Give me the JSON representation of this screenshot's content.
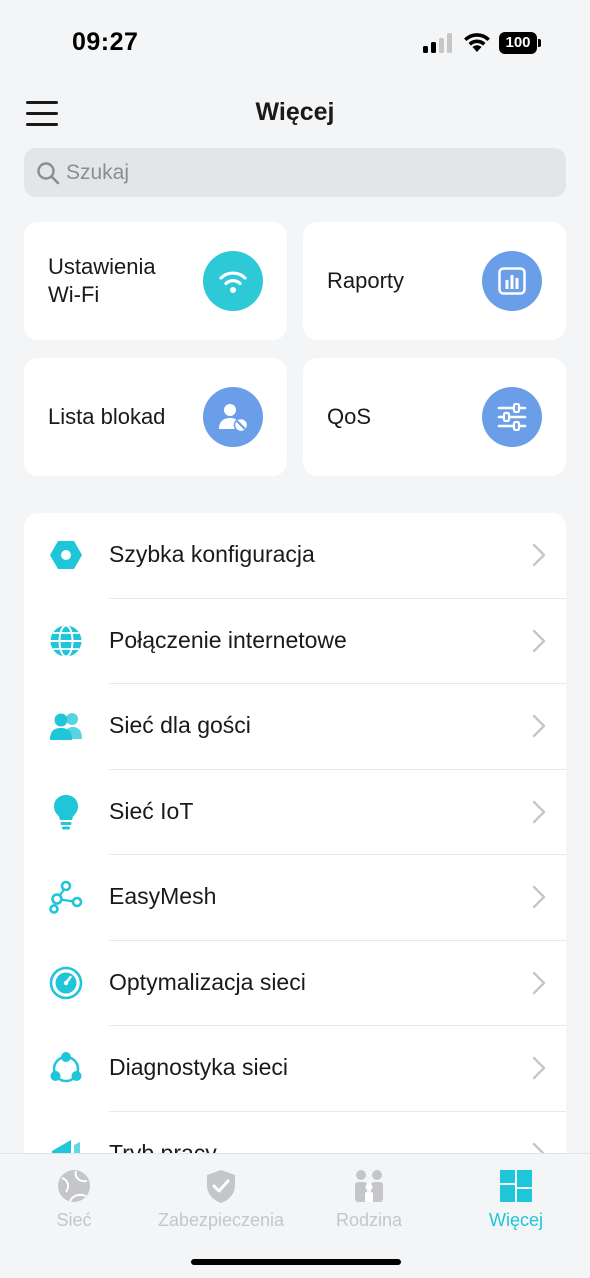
{
  "status_bar": {
    "time": "09:27",
    "battery": "100"
  },
  "header": {
    "title": "Więcej",
    "menu_icon": "hamburger-menu-icon"
  },
  "search": {
    "placeholder": "Szukaj"
  },
  "colors": {
    "accent": "#1fc5d8",
    "card_teal": "#2ec9d6",
    "card_blue": "#6a9ee8",
    "tab_inactive": "#c4c6ca"
  },
  "cards": [
    {
      "label": "Ustawienia\nWi-Fi",
      "icon": "wifi-icon"
    },
    {
      "label": "Raporty",
      "icon": "bar-chart-icon"
    },
    {
      "label": "Lista blokad",
      "icon": "user-block-icon"
    },
    {
      "label": "QoS",
      "icon": "sliders-icon"
    }
  ],
  "list_items": [
    {
      "label": "Szybka konfiguracja",
      "icon": "hexagon-icon"
    },
    {
      "label": "Połączenie internetowe",
      "icon": "globe-icon"
    },
    {
      "label": "Sieć dla gości",
      "icon": "guests-icon"
    },
    {
      "label": "Sieć IoT",
      "icon": "lightbulb-icon"
    },
    {
      "label": "EasyMesh",
      "icon": "mesh-nodes-icon"
    },
    {
      "label": "Optymalizacja sieci",
      "icon": "gauge-icon"
    },
    {
      "label": "Diagnostyka sieci",
      "icon": "diagnostics-icon"
    },
    {
      "label": "Tryb pracy",
      "icon": "operation-mode-icon"
    }
  ],
  "tabs": [
    {
      "label": "Sieć",
      "icon": "globe-icon",
      "active": false
    },
    {
      "label": "Zabezpieczenia",
      "icon": "shield-check-icon",
      "active": false
    },
    {
      "label": "Rodzina",
      "icon": "family-icon",
      "active": false
    },
    {
      "label": "Więcej",
      "icon": "grid-icon",
      "active": true
    }
  ]
}
